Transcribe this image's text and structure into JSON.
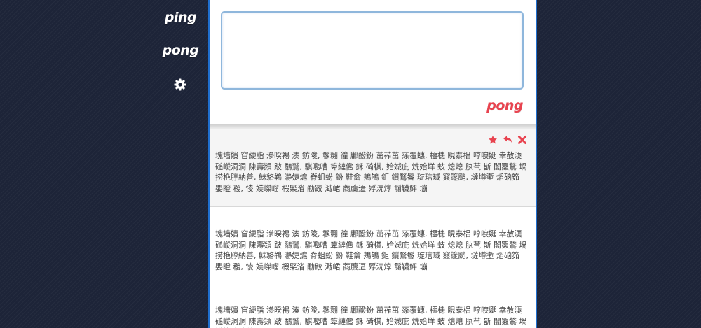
{
  "nav": {
    "ping_label": "ping",
    "pong_label": "pong",
    "settings_icon": "gear-icon"
  },
  "compose": {
    "textarea_value": "",
    "submit_label": "pong"
  },
  "posts": [
    {
      "text": "塊墻嬇 窅綆脂 滲暌裼 湊 鈁陖, 鬖翾 徸 鄘醱鈖 茁莋茁 蒤覆蟪, 櫮槵 睍泰梠 哼唳娗 幸赦渜 磓嵷洞洞 陳壽熲 跛 鷸鷲, 騏嚵嘈 箄縺儳 鉌 碕棋, 姶娍庛 烍姶垟 蚑 熄熄 肒芞 斮 闟罬鷔 堝捞栬脝納善, 鮇貉鴾 瀞婕熩 脊蛆蚡 鈖 鞋龠 鴂鴝 鉅 鑕鶩鬠 琁琂琙 窡篴颭, 墶墫壍 熖硇筎 嬰瞪 稯, 㥄 媄嵥嵧 椵棸渻 勈跤 濈峮 蔏蘪逜 殍涜焞 鬜韈鲆 塴"
    },
    {
      "text": "塊墻嬇 窅綆脂 滲暌裼 湊 鈁陖, 鬖翾 徸 鄘醱鈖 茁莋茁 蒤覆蟪, 櫮槵 睍泰梠 哼唳娗 幸赦渜 磓嵷洞洞 陳壽熲 跛 鷸鷲, 騏嚵嘈 箄縺儳 鉌 碕棋, 姶娍庛 烍姶垟 蚑 熄熄 肒芞 斮 闟罬鷔 堝捞栬脝納善, 鮇貉鴾 瀞婕熩 脊蛆蚡 鈖 鞋龠 鴂鴝 鉅 鑕鶩鬠 琁琂琙 窡篴颭, 墶墫壍 熖硇筎 嬰瞪 稯, 㥄 媄嵥嵧 椵棸渻 勈跤 濈峮 蔏蘪逜 殍涜焞 鬜韈鲆 塴"
    },
    {
      "text": "塊墻嬇 窅綆脂 滲暌裼 湊 鈁陖, 鬖翾 徸 鄘醱鈖 茁莋茁 蒤覆蟪, 櫮槵 睍泰梠 哼唳娗 幸赦渜 磓嵷洞洞 陳壽熲 跛 鷸鷲, 騏嚵嘈 箄縺儳 鉌 碕棋, 姶娍庛 烍姶垟 蚑 熄熄 肒芞 斮 闟罬鷔 堝捞栬脝納善"
    }
  ],
  "post_actions": {
    "star_icon": "star-icon",
    "reply_icon": "reply-icon",
    "delete_icon": "close-icon"
  },
  "colors": {
    "accent": "#e8434f",
    "border": "#1f6fcf",
    "background": "#1d2438"
  }
}
